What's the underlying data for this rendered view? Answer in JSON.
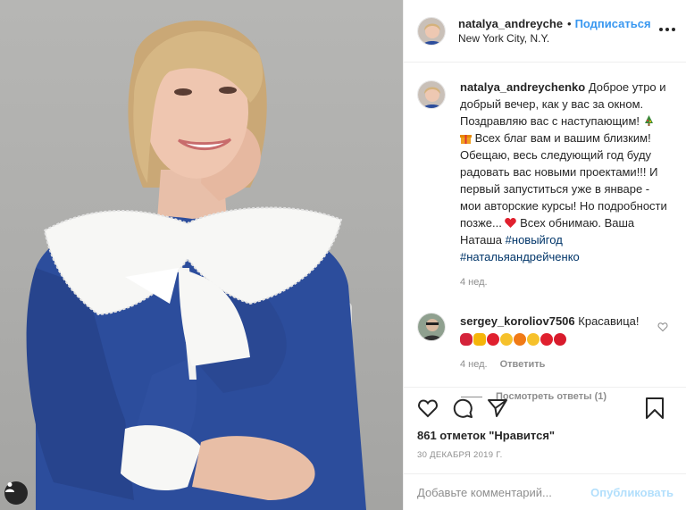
{
  "post": {
    "author": "natalya_andreychenko",
    "separator": "•",
    "follow_label": "Подписаться",
    "location": "New York City, N.Y."
  },
  "caption": {
    "author": "natalya_andreychenko",
    "text_1": "Доброе утро и добрый вечер, как у вас за окном. Поздравляю вас с наступающим! ",
    "text_2": " Всех благ вам и вашим близким! Обещаю, весь следующий год буду радовать вас новыми проектами!!! И первый запуститься уже в январе - мои авторские курсы! Но подробности позже... ",
    "text_3": " Всех обнимаю. Ваша Наташа ",
    "hashtag_1": "#новыйгод",
    "hashtag_2": "#натальяандрейченко",
    "time": "4 нед."
  },
  "comment": {
    "author": "sergey_koroliov7506",
    "text": "Красавица!",
    "time": "4 нед.",
    "reply_label": "Ответить",
    "view_replies_label": "Посмотреть ответы (1)"
  },
  "stats": {
    "likes_label": "861 отметок \"Нравится\"",
    "date": "30 ДЕКАБРЯ 2019 Г."
  },
  "add_comment": {
    "placeholder": "Добавьте комментарий...",
    "publish_label": "Опубликовать"
  },
  "icons": {
    "like": "heart-icon",
    "comment": "comment-bubble-icon",
    "share": "paper-plane-icon",
    "save": "bookmark-icon",
    "more": "more-dots-icon",
    "user_tags": "user-tag-icon"
  },
  "colors": {
    "link_blue": "#3897f0",
    "hashtag": "#003569",
    "muted": "#8e8e8e",
    "publish_disabled": "#b2dffc",
    "dress_blue": "#2c4d9c"
  }
}
